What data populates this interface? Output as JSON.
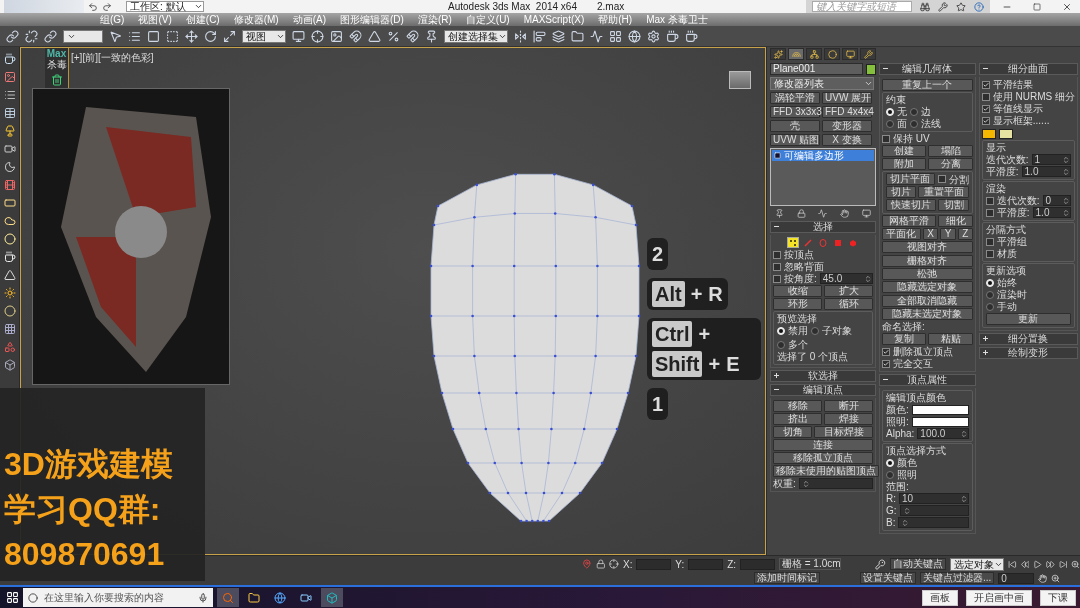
{
  "title_bar": {
    "workspace": "工作区: 默认",
    "app_title": "Autodesk 3ds Max  2014 x64",
    "file_name": "2.max",
    "search": {
      "placeholder": "键入关键字或短语"
    }
  },
  "menu": [
    "组(G)",
    "视图(V)",
    "创建(C)",
    "修改器(M)",
    "动画(A)",
    "图形编辑器(D)",
    "渲染(R)",
    "自定义(U)",
    "MAXScript(X)",
    "帮助(H)",
    "Max 杀毒卫士"
  ],
  "toolbar": {
    "view_dropdown": "视图",
    "selection_set": "创建选择集"
  },
  "plugin_panel": {
    "title": "Max",
    "subtitle": "杀毒"
  },
  "viewport": {
    "label": "[+][前][一致的色彩]"
  },
  "command_panel": {
    "tabs": [
      {
        "selected": false
      },
      {
        "selected": true
      },
      {
        "selected": false
      },
      {
        "selected": false
      },
      {
        "selected": false
      },
      {
        "selected": false
      }
    ],
    "object_name": "Plane001",
    "modifier_list": "修改器列表",
    "modifier_buttons": [
      "涡轮平滑",
      "UVW 展开",
      "FFD 3x3x3",
      "FFD 4x4x4",
      "壳",
      "变形器",
      "UVW 贴图",
      "X 变换"
    ],
    "stack": [
      {
        "label": "可编辑多边形",
        "selected": true
      }
    ],
    "columns": [
      [
        {
          "title": "选择",
          "expanded": true,
          "items": [
            {
              "kind": "subobjects",
              "options": [
                {
                  "selected": true
                },
                {
                  "selected": false
                },
                {
                  "selected": false
                },
                {
                  "selected": false
                },
                {
                  "selected": false
                }
              ]
            },
            {
              "kind": "checkbox",
              "label": "按顶点",
              "checked": false
            },
            {
              "kind": "checkbox",
              "label": "忽略背面",
              "checked": false
            },
            {
              "kind": "spinner",
              "label": "按角度:",
              "value": "45.0",
              "checkbox": false
            },
            {
              "kind": "buttons",
              "labels": [
                "收缩",
                "扩大"
              ]
            },
            {
              "kind": "buttons",
              "labels": [
                "环形",
                "循环"
              ]
            },
            {
              "kind": "group",
              "title": "预览选择",
              "items": [
                {
                  "kind": "radios",
                  "options": [
                    {
                      "label": "禁用",
                      "selected": true
                    },
                    {
                      "label": "子对象",
                      "selected": false
                    },
                    {
                      "label": "多个",
                      "selected": false
                    }
                  ]
                },
                {
                  "kind": "text",
                  "text": "选择了 0 个顶点"
                }
              ]
            }
          ]
        },
        {
          "title": "软选择",
          "expanded": false
        },
        {
          "title": "编辑顶点",
          "expanded": true,
          "items": [
            {
              "kind": "buttons",
              "labels": [
                "移除",
                "断开"
              ]
            },
            {
              "kind": "buttons",
              "labels": [
                "挤出",
                "焊接"
              ]
            },
            {
              "kind": "buttons",
              "labels": [
                "切角",
                "目标焊接"
              ]
            },
            {
              "kind": "buttons",
              "labels": [
                "连接"
              ]
            },
            {
              "kind": "buttons",
              "labels": [
                "移除孤立顶点"
              ]
            },
            {
              "kind": "buttons",
              "labels": [
                "移除未使用的贴图顶点"
              ]
            },
            {
              "kind": "spinner",
              "label": "权重:"
            }
          ]
        }
      ],
      [
        {
          "title": "编辑几何体",
          "expanded": true,
          "items": [
            {
              "kind": "buttons",
              "labels": [
                "重复上一个"
              ]
            },
            {
              "kind": "group",
              "title": "约束",
              "items": [
                {
                  "kind": "radios",
                  "options": [
                    {
                      "label": "无",
                      "selected": true
                    },
                    {
                      "label": "边",
                      "selected": false
                    }
                  ]
                },
                {
                  "kind": "radios",
                  "options": [
                    {
                      "label": "面",
                      "selected": false
                    },
                    {
                      "label": "法线",
                      "selected": false
                    }
                  ]
                }
              ]
            },
            {
              "kind": "checkbox",
              "label": "保持 UV",
              "checked": false
            },
            {
              "kind": "buttons",
              "labels": [
                "创建",
                "塌陷"
              ]
            },
            {
              "kind": "buttons",
              "labels": [
                "附加",
                "分离"
              ]
            },
            {
              "kind": "group",
              "items": [
                {
                  "kind": "button_checkbox",
                  "label": "切片平面",
                  "check_label": "分割",
                  "checked": false
                },
                {
                  "kind": "buttons",
                  "labels": [
                    "切片",
                    "重置平面"
                  ]
                },
                {
                  "kind": "buttons",
                  "labels": [
                    "快速切片",
                    "切割"
                  ]
                }
              ]
            },
            {
              "kind": "buttons",
              "labels": [
                "网格平滑",
                "细化"
              ]
            },
            {
              "kind": "buttons",
              "labels": [
                "平面化",
                "X",
                "Y",
                "Z"
              ]
            },
            {
              "kind": "buttons",
              "labels": [
                "视图对齐",
                "栅格对齐"
              ]
            },
            {
              "kind": "buttons",
              "labels": [
                "松弛"
              ]
            },
            {
              "kind": "buttons",
              "labels": [
                "隐藏选定对象",
                "全部取消隐藏"
              ]
            },
            {
              "kind": "buttons",
              "labels": [
                "隐藏未选定对象"
              ]
            },
            {
              "kind": "text",
              "text": "命名选择:"
            },
            {
              "kind": "buttons",
              "labels": [
                "复制",
                "粘贴"
              ]
            },
            {
              "kind": "checkbox",
              "label": "删除孤立顶点",
              "checked": true
            },
            {
              "kind": "checkbox",
              "label": "完全交互",
              "checked": true
            }
          ]
        },
        {
          "title": "顶点属性",
          "expanded": true,
          "items": [
            {
              "kind": "group",
              "title": "编辑顶点颜色",
              "items": [
                {
                  "kind": "swatch",
                  "label": "颜色:",
                  "color": "#ffffff"
                },
                {
                  "kind": "swatch",
                  "label": "照明:",
                  "color": "#ffffff"
                },
                {
                  "kind": "spinner",
                  "label": "Alpha:",
                  "value": "100.0"
                }
              ]
            },
            {
              "kind": "group",
              "title": "顶点选择方式",
              "items": [
                {
                  "kind": "radios",
                  "options": [
                    {
                      "label": "颜色",
                      "selected": true
                    }
                  ]
                },
                {
                  "kind": "radios",
                  "options": [
                    {
                      "label": "照明",
                      "selected": false
                    }
                  ]
                },
                {
                  "kind": "text",
                  "text": "范围:"
                },
                {
                  "kind": "spinner",
                  "label": "R:",
                  "value": "10"
                },
                {
                  "kind": "spinner",
                  "label": "G:"
                },
                {
                  "kind": "spinner",
                  "label": "B:"
                }
              ]
            }
          ]
        }
      ],
      [
        {
          "title": "细分曲面",
          "expanded": true,
          "items": [
            {
              "kind": "checkbox",
              "label": "平滑结果",
              "checked": true
            },
            {
              "kind": "checkbox",
              "label": "使用 NURMS 细分",
              "checked": false
            },
            {
              "kind": "checkbox",
              "label": "等值线显示",
              "checked": true
            },
            {
              "kind": "checkbox",
              "label": "显示框架......",
              "checked": true,
              "swatches": [
                {
                  "color": "#f5b800"
                },
                {
                  "color": "#e6e3a2"
                }
              ]
            },
            {
              "kind": "group",
              "title": "显示",
              "items": [
                {
                  "kind": "spinner",
                  "label": "迭代次数:",
                  "value": "1"
                },
                {
                  "kind": "spinner",
                  "label": "平滑度:",
                  "value": "1.0"
                }
              ]
            },
            {
              "kind": "group",
              "title": "渲染",
              "items": [
                {
                  "kind": "spinner",
                  "label": "迭代次数:",
                  "value": "0",
                  "checkbox": false
                },
                {
                  "kind": "spinner",
                  "label": "平滑度:",
                  "value": "1.0",
                  "checkbox": false
                }
              ]
            },
            {
              "kind": "group",
              "title": "分隔方式",
              "items": [
                {
                  "kind": "checkbox",
                  "label": "平滑组",
                  "checked": false
                },
                {
                  "kind": "checkbox",
                  "label": "材质",
                  "checked": false
                }
              ]
            },
            {
              "kind": "group",
              "title": "更新选项",
              "items": [
                {
                  "kind": "radios",
                  "options": [
                    {
                      "label": "始终",
                      "selected": true
                    }
                  ]
                },
                {
                  "kind": "radios",
                  "options": [
                    {
                      "label": "渲染时",
                      "selected": false
                    }
                  ]
                },
                {
                  "kind": "radios",
                  "options": [
                    {
                      "label": "手动",
                      "selected": false
                    }
                  ]
                },
                {
                  "kind": "buttons",
                  "labels": [
                    "更新"
                  ]
                }
              ]
            }
          ]
        },
        {
          "title": "细分置换",
          "expanded": false
        },
        {
          "title": "绘制变形",
          "expanded": false
        }
      ]
    ]
  },
  "promo": [
    "3D游戏建模",
    "学习QQ群:",
    "809870691"
  ],
  "key_hints": [
    {
      "items": [
        {
          "kind": "plain",
          "text": "2"
        }
      ]
    },
    {
      "items": [
        {
          "kind": "key",
          "text": "Alt"
        },
        {
          "kind": "plus",
          "text": "+"
        },
        {
          "kind": "plain",
          "text": "R"
        }
      ]
    },
    {
      "items": [
        {
          "kind": "key",
          "text": "Ctrl"
        },
        {
          "kind": "plus",
          "text": "+"
        },
        {
          "kind": "key",
          "text": "Shift"
        },
        {
          "kind": "plus",
          "text": "+"
        },
        {
          "kind": "plain",
          "text": "E"
        }
      ]
    },
    {
      "items": [
        {
          "kind": "plain",
          "text": "1"
        }
      ]
    }
  ],
  "status_bar": {
    "fields": [
      {
        "label": "X:"
      },
      {
        "label": "Y:"
      },
      {
        "label": "Z:"
      }
    ],
    "grid": "栅格 = 1.0cm",
    "add_time_tag": "添加时间标记",
    "auto_key": "自动关键点",
    "set_key": "设置关键点",
    "selection_filter": "选定对象",
    "key_filters": "关键点过滤器...",
    "frame": "0"
  },
  "taskbar": {
    "search": {
      "placeholder": "在这里输入你要搜索的内容"
    },
    "buttons": [
      "画板",
      "开启画中画",
      "下课"
    ]
  }
}
